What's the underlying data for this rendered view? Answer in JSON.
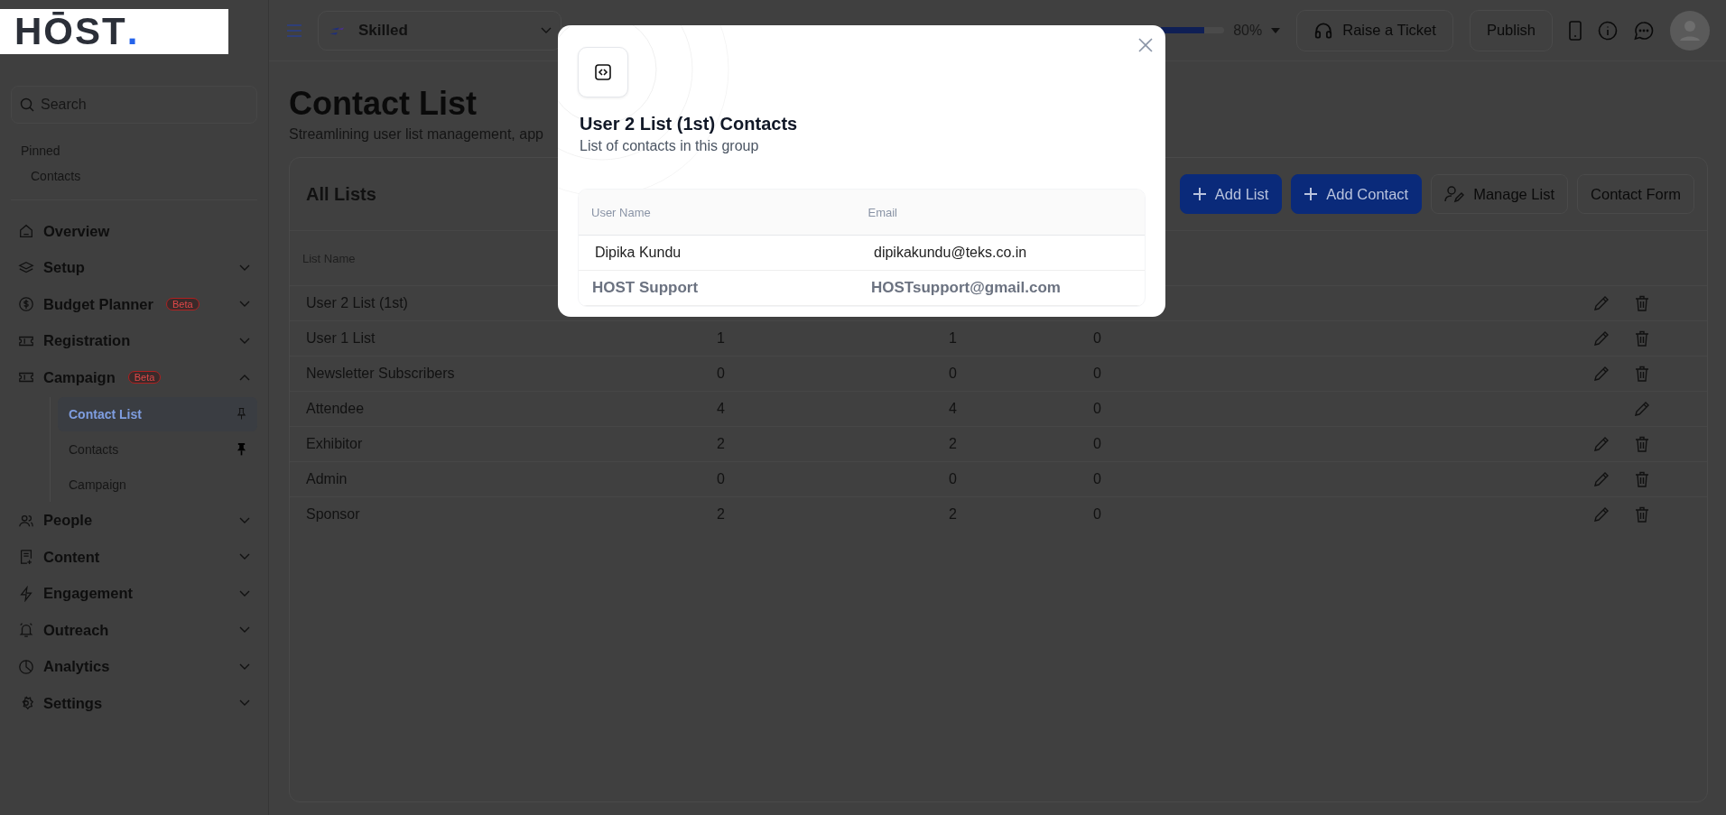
{
  "logo": {
    "text": "HŌST",
    "dot": "."
  },
  "sidebar": {
    "search": {
      "placeholder": "Search"
    },
    "pinned_title": "Pinned",
    "pinned": [
      "Contacts"
    ],
    "items": [
      {
        "label": "Overview"
      },
      {
        "label": "Setup",
        "expanded": false
      },
      {
        "label": "Budget Planner",
        "badge": "Beta",
        "expanded": false
      },
      {
        "label": "Registration",
        "expanded": false
      },
      {
        "label": "Campaign",
        "badge": "Beta",
        "expanded": true,
        "children": [
          {
            "label": "Contact List",
            "selected": true,
            "pinned": false
          },
          {
            "label": "Contacts",
            "selected": false,
            "pinned": true
          },
          {
            "label": "Campaign",
            "selected": false
          }
        ]
      },
      {
        "label": "People",
        "expanded": false
      },
      {
        "label": "Content",
        "expanded": false
      },
      {
        "label": "Engagement",
        "expanded": false
      },
      {
        "label": "Outreach",
        "expanded": false
      },
      {
        "label": "Analytics",
        "expanded": false
      },
      {
        "label": "Settings",
        "expanded": false
      }
    ]
  },
  "topbar": {
    "event": "Skilled",
    "progress": {
      "level": 0.8,
      "reading": "80%"
    },
    "buttons": [
      "Raise a Ticket",
      "Publish"
    ]
  },
  "page": {
    "title": "Contact List",
    "subtitle": "Streamlining user list management, app"
  },
  "card": {
    "title": "All Lists",
    "buttons": [
      {
        "label": "Add List",
        "kind": "primary"
      },
      {
        "label": "Add Contact",
        "kind": "primary"
      },
      {
        "label": "Manage List",
        "kind": "icon"
      },
      {
        "label": "Contact Form",
        "kind": "plain"
      }
    ],
    "columns": [
      "List Name"
    ],
    "rows": [
      {
        "cells": [
          "User 2 List (1st)"
        ],
        "deletable": true
      },
      {
        "cells": [
          "User 1 List",
          "1",
          "1",
          "0"
        ],
        "deletable": true
      },
      {
        "cells": [
          "Newsletter Subscribers",
          "0",
          "0",
          "0"
        ],
        "deletable": true
      },
      {
        "cells": [
          "Attendee",
          "4",
          "4",
          "0"
        ],
        "deletable": false
      },
      {
        "cells": [
          "Exhibitor",
          "2",
          "2",
          "0"
        ],
        "deletable": true
      },
      {
        "cells": [
          "Admin",
          "0",
          "0",
          "0"
        ],
        "deletable": true
      },
      {
        "cells": [
          "Sponsor",
          "2",
          "2",
          "0"
        ],
        "deletable": true
      }
    ]
  },
  "modal": {
    "title": "User 2 List (1st) Contacts",
    "subtitle": "List of contacts in this group",
    "columns": [
      "User Name",
      "Email"
    ],
    "rows": [
      {
        "name": "Dipika Kundu",
        "email": "dipikakundu@teks.co.in",
        "bold": false
      },
      {
        "name": "HOST Support",
        "email": "HOSTsupport@gmail.com",
        "bold": true
      }
    ]
  }
}
